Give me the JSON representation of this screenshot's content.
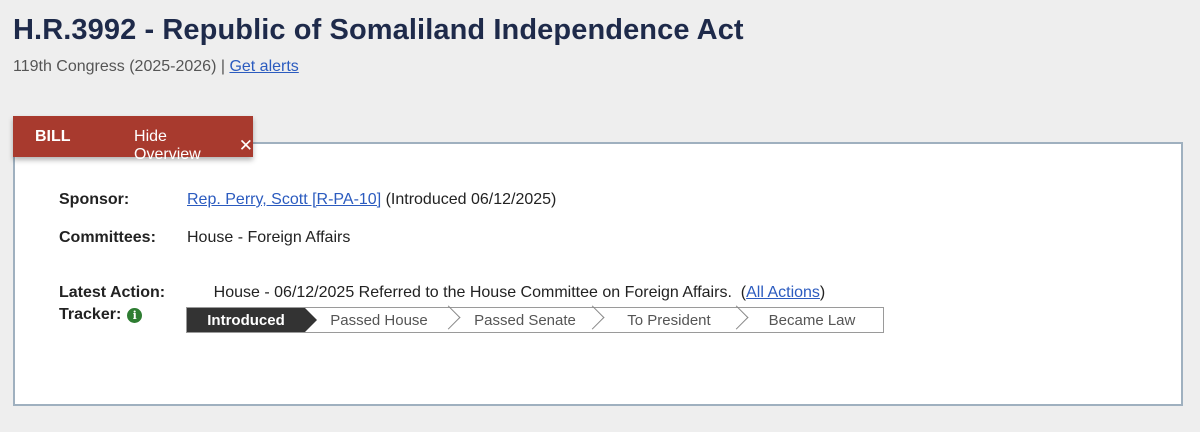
{
  "header": {
    "title": "H.R.3992 - Republic of Somaliland Independence Act",
    "congress": "119th Congress (2025-2026)",
    "separator": " | ",
    "alerts_link": "Get alerts"
  },
  "tabs": {
    "bill": "BILL",
    "hide_overview": "Hide Overview",
    "hide_icon": "close-icon"
  },
  "overview": {
    "sponsor_label": "Sponsor:",
    "sponsor_link": "Rep. Perry, Scott [R-PA-10]",
    "sponsor_introduced": " (Introduced 06/12/2025)",
    "committees_label": "Committees:",
    "committees_value": "House - Foreign Affairs",
    "latest_action_label": "Latest Action:",
    "latest_action_value": "House - 06/12/2025 Referred to the House Committee on Foreign Affairs.  (",
    "all_actions_link": "All Actions",
    "latest_action_close": ")",
    "tracker_label": "Tracker:",
    "tracker_steps": [
      "Introduced",
      "Passed House",
      "Passed Senate",
      "To President",
      "Became Law"
    ],
    "tracker_current_index": 0
  },
  "colors": {
    "tab_bg": "#a83a2e",
    "title": "#1e2a4a",
    "link": "#2b5bbf",
    "tracker_current": "#333333",
    "info_icon": "#2e7d32"
  }
}
